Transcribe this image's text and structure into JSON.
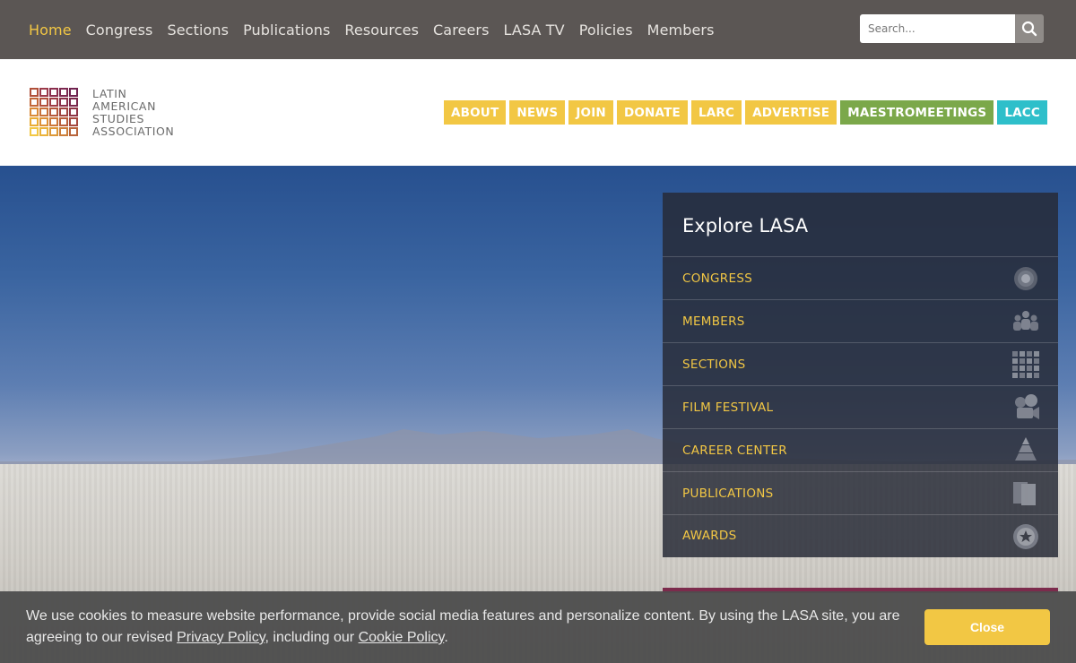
{
  "topnav": {
    "items": [
      {
        "label": "Home",
        "active": true
      },
      {
        "label": "Congress"
      },
      {
        "label": "Sections"
      },
      {
        "label": "Publications"
      },
      {
        "label": "Resources"
      },
      {
        "label": "Careers"
      },
      {
        "label": "LASA TV"
      },
      {
        "label": "Policies"
      },
      {
        "label": "Members"
      }
    ],
    "search_placeholder": "Search..."
  },
  "logo": {
    "line1": "LATIN",
    "line2": "AMERICAN",
    "line3": "STUDIES",
    "line4": "ASSOCIATION"
  },
  "header_pills": [
    {
      "label": "ABOUT",
      "color": "#f2c744"
    },
    {
      "label": "NEWS",
      "color": "#f2c744"
    },
    {
      "label": "JOIN",
      "color": "#f2c744"
    },
    {
      "label": "DONATE",
      "color": "#f2c744"
    },
    {
      "label": "LARC",
      "color": "#f2c744"
    },
    {
      "label": "ADVERTISE",
      "color": "#f2c744"
    },
    {
      "label": "MAESTROMEETINGS",
      "color": "#7ba84a"
    },
    {
      "label": "LACC",
      "color": "#2ebfca"
    }
  ],
  "explore": {
    "title": "Explore LASA",
    "items": [
      {
        "label": "CONGRESS",
        "icon": "target-icon"
      },
      {
        "label": "MEMBERS",
        "icon": "people-icon"
      },
      {
        "label": "SECTIONS",
        "icon": "grid-icon"
      },
      {
        "label": "FILM FESTIVAL",
        "icon": "film-camera-icon"
      },
      {
        "label": "CAREER CENTER",
        "icon": "pyramid-icon"
      },
      {
        "label": "PUBLICATIONS",
        "icon": "books-icon"
      },
      {
        "label": "AWARDS",
        "icon": "award-star-icon"
      }
    ]
  },
  "cookie": {
    "text_before": "We use cookies to measure website performance, provide social media features and personalize content. By using the LASA site, you are agreeing to our revised ",
    "privacy_link": "Privacy Policy",
    "text_middle": ", including our ",
    "cookie_link": "Cookie Policy",
    "text_after": ".",
    "close_label": "Close"
  },
  "colors": {
    "accent_yellow": "#f2c744",
    "accent_green": "#7ba84a",
    "accent_teal": "#2ebfca",
    "topbar": "#5b5654"
  }
}
